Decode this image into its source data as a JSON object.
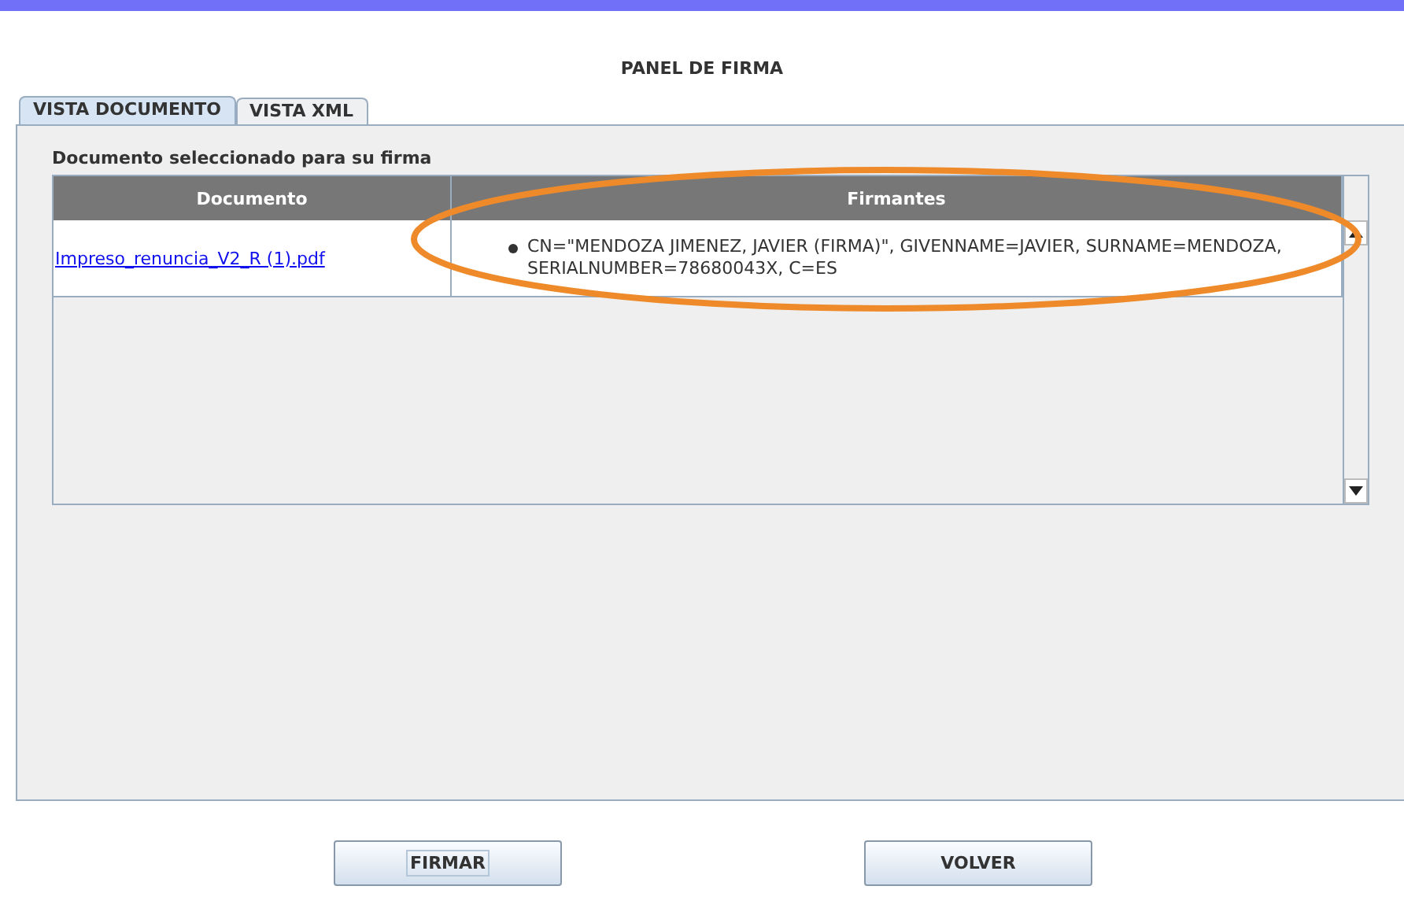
{
  "title": "PANEL DE FIRMA",
  "tabs": [
    {
      "label": "VISTA DOCUMENTO",
      "selected": true
    },
    {
      "label": "VISTA XML",
      "selected": false
    }
  ],
  "section_label": "Documento seleccionado para su firma",
  "table": {
    "columns": [
      "Documento",
      "Firmantes"
    ],
    "rows": [
      {
        "document": "Impreso_renuncia_V2_R (1).pdf",
        "signers": [
          "CN=\"MENDOZA JIMENEZ, JAVIER (FIRMA)\", GIVENNAME=JAVIER, SURNAME=MENDOZA, SERIALNUMBER=78680043X, C=ES"
        ]
      }
    ]
  },
  "buttons": [
    {
      "label": "FIRMAR",
      "focused": true
    },
    {
      "label": "VOLVER",
      "focused": false
    }
  ]
}
